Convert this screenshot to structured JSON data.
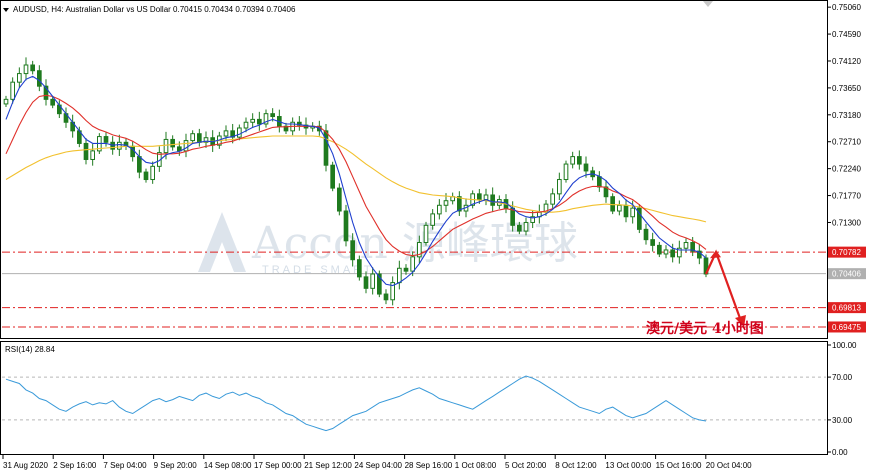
{
  "header": {
    "symbol_line": "AUDUSD, H4:  Australian Dollar vs US Dollar  0.70415 0.70434 0.70394 0.70406"
  },
  "rsi_header": "RSI(14) 28.84",
  "annotation": "澳元/美元  4小时图",
  "watermark": {
    "brand": "Accon 源峰環球",
    "sub": "TRADE SMART"
  },
  "colors": {
    "candle": "#1f7a1f",
    "ma_fast": "#1f3fcf",
    "ma_mid": "#e0302a",
    "ma_slow": "#f2c12e",
    "rsi": "#3a9ad9",
    "level": "#e02020",
    "arrow": "#e02020",
    "price_tag": "#e02020",
    "current_tag": "#b0b0b0"
  },
  "chart_data": [
    {
      "type": "candlestick",
      "title": "AUDUSD, H4",
      "ylim": [
        0.693,
        0.7515
      ],
      "y_ticks": [
        "0.75060",
        "0.74590",
        "0.74120",
        "0.73650",
        "0.73180",
        "0.72710",
        "0.72240",
        "0.71770",
        "0.71300",
        "0.70782",
        "0.70406",
        "0.69813",
        "0.69475"
      ],
      "y_tick_values": [
        0.7506,
        0.7459,
        0.7412,
        0.7365,
        0.7318,
        0.7271,
        0.7224,
        0.7177,
        0.713
      ],
      "x_labels": [
        "31 Aug 2020",
        "2 Sep 16:00",
        "7 Sep 04:00",
        "9 Sep 20:00",
        "14 Sep 08:00",
        "17 Sep 00:00",
        "21 Sep 12:00",
        "24 Sep 04:00",
        "28 Sep 16:00",
        "1 Oct 08:00",
        "5 Oct 20:00",
        "8 Oct 12:00",
        "13 Oct 00:00",
        "15 Oct 16:00",
        "20 Oct 04:00"
      ],
      "horizontal_levels": [
        {
          "value": 0.70782,
          "label": "0.70782",
          "style": "dash-dot"
        },
        {
          "value": 0.69813,
          "label": "0.69813",
          "style": "dash-dot"
        },
        {
          "value": 0.69475,
          "label": "0.69475",
          "style": "dash-dot"
        }
      ],
      "current_price": {
        "value": 0.70406,
        "label": "0.70406"
      },
      "close_series": [
        0.7345,
        0.7375,
        0.739,
        0.7405,
        0.7395,
        0.7368,
        0.7345,
        0.7335,
        0.732,
        0.7305,
        0.729,
        0.7268,
        0.724,
        0.7255,
        0.728,
        0.727,
        0.7258,
        0.727,
        0.7263,
        0.7245,
        0.7218,
        0.7205,
        0.7228,
        0.7252,
        0.7275,
        0.7262,
        0.7255,
        0.7273,
        0.7285,
        0.727,
        0.7278,
        0.7265,
        0.7281,
        0.729,
        0.7279,
        0.7295,
        0.7305,
        0.731,
        0.7302,
        0.732,
        0.7315,
        0.7298,
        0.729,
        0.7305,
        0.73,
        0.7295,
        0.7298,
        0.729,
        0.723,
        0.719,
        0.715,
        0.7098,
        0.7065,
        0.7035,
        0.7015,
        0.704,
        0.7005,
        0.6995,
        0.7025,
        0.705,
        0.7045,
        0.707,
        0.7095,
        0.7125,
        0.7145,
        0.716,
        0.7168,
        0.7175,
        0.715,
        0.716,
        0.718,
        0.717,
        0.7178,
        0.716,
        0.717,
        0.7155,
        0.7125,
        0.7115,
        0.713,
        0.714,
        0.7148,
        0.7162,
        0.718,
        0.7205,
        0.7232,
        0.7245,
        0.7232,
        0.722,
        0.721,
        0.7192,
        0.7175,
        0.715,
        0.716,
        0.714,
        0.7155,
        0.7118,
        0.71,
        0.709,
        0.7075,
        0.7082,
        0.707,
        0.7085,
        0.7095,
        0.708,
        0.7068,
        0.704
      ],
      "ma_fast": [
        0.731,
        0.734,
        0.7365,
        0.738,
        0.7385,
        0.7378,
        0.7365,
        0.735,
        0.7335,
        0.732,
        0.7305,
        0.729,
        0.7275,
        0.7268,
        0.7268,
        0.7268,
        0.7265,
        0.7266,
        0.7265,
        0.7258,
        0.7245,
        0.7235,
        0.7233,
        0.7238,
        0.7248,
        0.7252,
        0.7254,
        0.726,
        0.7268,
        0.727,
        0.7272,
        0.7271,
        0.7274,
        0.7278,
        0.728,
        0.7284,
        0.729,
        0.7296,
        0.73,
        0.7306,
        0.731,
        0.7306,
        0.7302,
        0.7302,
        0.7301,
        0.7299,
        0.7298,
        0.7295,
        0.7275,
        0.725,
        0.7215,
        0.7172,
        0.713,
        0.7095,
        0.7068,
        0.705,
        0.7035,
        0.7022,
        0.702,
        0.7025,
        0.7033,
        0.7043,
        0.7058,
        0.7077,
        0.7097,
        0.7115,
        0.7132,
        0.7146,
        0.7152,
        0.7156,
        0.7162,
        0.7166,
        0.717,
        0.7166,
        0.7166,
        0.7164,
        0.7155,
        0.7145,
        0.714,
        0.7138,
        0.714,
        0.7145,
        0.7153,
        0.7165,
        0.7182,
        0.7198,
        0.7208,
        0.7213,
        0.7215,
        0.7211,
        0.7203,
        0.719,
        0.7181,
        0.7169,
        0.7161,
        0.7146,
        0.7131,
        0.7117,
        0.7103,
        0.7094,
        0.7085,
        0.7082,
        0.7082,
        0.7082,
        0.7078,
        0.7068
      ],
      "ma_mid": [
        0.725,
        0.7275,
        0.73,
        0.7322,
        0.734,
        0.735,
        0.7352,
        0.735,
        0.7345,
        0.7338,
        0.733,
        0.732,
        0.7308,
        0.7298,
        0.7292,
        0.7288,
        0.7283,
        0.728,
        0.7277,
        0.7272,
        0.7265,
        0.7257,
        0.7251,
        0.7249,
        0.725,
        0.725,
        0.7251,
        0.7254,
        0.7258,
        0.726,
        0.7263,
        0.7265,
        0.7267,
        0.727,
        0.7272,
        0.7276,
        0.728,
        0.7284,
        0.7288,
        0.7292,
        0.7296,
        0.7297,
        0.7297,
        0.7298,
        0.7298,
        0.7298,
        0.7298,
        0.7297,
        0.7288,
        0.7275,
        0.7258,
        0.7236,
        0.721,
        0.7184,
        0.7158,
        0.7138,
        0.7118,
        0.71,
        0.7088,
        0.708,
        0.7074,
        0.7072,
        0.7074,
        0.708,
        0.7088,
        0.7098,
        0.7108,
        0.7118,
        0.7124,
        0.713,
        0.7136,
        0.7141,
        0.7146,
        0.7149,
        0.7152,
        0.7154,
        0.7152,
        0.7149,
        0.7148,
        0.7147,
        0.7148,
        0.715,
        0.7154,
        0.716,
        0.7168,
        0.7178,
        0.7185,
        0.719,
        0.7193,
        0.7193,
        0.7191,
        0.7185,
        0.7181,
        0.7175,
        0.717,
        0.7161,
        0.7151,
        0.7141,
        0.713,
        0.7122,
        0.7113,
        0.7107,
        0.7103,
        0.7098,
        0.7092,
        0.7083
      ],
      "ma_slow": [
        0.7205,
        0.7212,
        0.7219,
        0.7226,
        0.7232,
        0.7238,
        0.7243,
        0.7247,
        0.725,
        0.7253,
        0.7255,
        0.7256,
        0.7257,
        0.7258,
        0.7259,
        0.726,
        0.7261,
        0.7262,
        0.7263,
        0.7263,
        0.7263,
        0.7263,
        0.7263,
        0.7264,
        0.7265,
        0.7266,
        0.7267,
        0.7268,
        0.7269,
        0.727,
        0.7271,
        0.7272,
        0.7273,
        0.7274,
        0.7275,
        0.7276,
        0.7277,
        0.7278,
        0.7279,
        0.728,
        0.7281,
        0.7281,
        0.7281,
        0.7281,
        0.7281,
        0.7281,
        0.7281,
        0.728,
        0.7276,
        0.7271,
        0.7265,
        0.7258,
        0.725,
        0.7241,
        0.7232,
        0.7224,
        0.7216,
        0.7208,
        0.7201,
        0.7195,
        0.719,
        0.7186,
        0.7182,
        0.718,
        0.7178,
        0.7177,
        0.7176,
        0.7175,
        0.7173,
        0.7171,
        0.717,
        0.7169,
        0.7168,
        0.7166,
        0.7164,
        0.7162,
        0.7159,
        0.7156,
        0.7153,
        0.7151,
        0.7149,
        0.7148,
        0.7148,
        0.7149,
        0.7151,
        0.7154,
        0.7156,
        0.7158,
        0.716,
        0.7161,
        0.7162,
        0.7161,
        0.7161,
        0.716,
        0.7159,
        0.7157,
        0.7154,
        0.7151,
        0.7148,
        0.7145,
        0.7142,
        0.714,
        0.7138,
        0.7136,
        0.7134,
        0.7131
      ],
      "projection": {
        "from": 0.704,
        "peak": 0.7078,
        "target": 0.69475
      }
    },
    {
      "type": "line",
      "title": "RSI(14) 28.84",
      "ylim": [
        0,
        100
      ],
      "y_ticks": [
        "100.00",
        "70.00",
        "30.00",
        "0.00"
      ],
      "y_tick_values": [
        100,
        70,
        30,
        0
      ],
      "values": [
        68,
        66,
        64,
        58,
        55,
        50,
        48,
        44,
        40,
        38,
        42,
        45,
        47,
        44,
        46,
        45,
        48,
        42,
        38,
        36,
        40,
        44,
        48,
        50,
        47,
        49,
        52,
        50,
        48,
        53,
        55,
        52,
        50,
        54,
        56,
        53,
        55,
        52,
        50,
        46,
        44,
        40,
        36,
        34,
        30,
        26,
        24,
        22,
        20,
        22,
        26,
        30,
        34,
        36,
        38,
        42,
        46,
        48,
        50,
        52,
        55,
        58,
        60,
        57,
        54,
        50,
        48,
        46,
        44,
        42,
        40,
        44,
        48,
        52,
        56,
        60,
        64,
        68,
        71,
        69,
        66,
        62,
        58,
        54,
        50,
        46,
        42,
        40,
        38,
        36,
        40,
        42,
        38,
        34,
        32,
        34,
        36,
        40,
        44,
        48,
        44,
        40,
        36,
        32,
        30,
        29
      ]
    }
  ]
}
